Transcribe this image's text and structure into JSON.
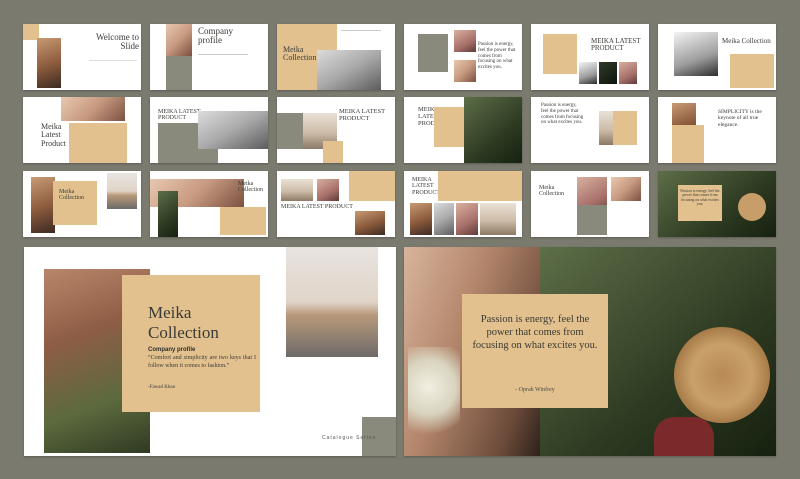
{
  "thumbs": {
    "s1_title": "Welcome to Slide",
    "s2_title": "Company profile",
    "s3_title": "Meika Collection",
    "s4_quote": "Passion is energy, feel the power that comes from focusing on what excites you.",
    "s5_title": "MEIKA LATEST PRODUCT",
    "s6_title": "Meika Collection",
    "s7_title": "Meika Latest Product",
    "s8_title": "MEIKA LATEST PRODUCT",
    "s9_title": "MEIKA LATEST PRODUCT",
    "s10_title": "MEIKA LATEST PRODUCT",
    "s11_quote": "Passion is energy, feel the power that comes from focusing on what excites you.",
    "s12_title": "SIMPLICITY is the keynote of all true elegance.",
    "s13_title": "Meika Collection",
    "s14_title": "Meika Collection",
    "s15_title": "MEIKA LATEST PRODUCT",
    "s16_title": "MEIKA LATEST PRODUCT",
    "s17_title": "Meika Collection",
    "s18_quote": "Passion is energy, feel the power that comes from focusing on what excites you."
  },
  "feature_left": {
    "title": "Meika Collection",
    "subtitle": "Company profile",
    "quote": "“Comfort and simplicity are two keys that I follow when it comes to fashion.”",
    "author": "-Fawad Khan",
    "footer": "Catalogue Series"
  },
  "feature_right": {
    "quote": "Passion is energy, feel the power that comes from focusing on what excites you.",
    "author": "- Oprah Winfrey"
  }
}
